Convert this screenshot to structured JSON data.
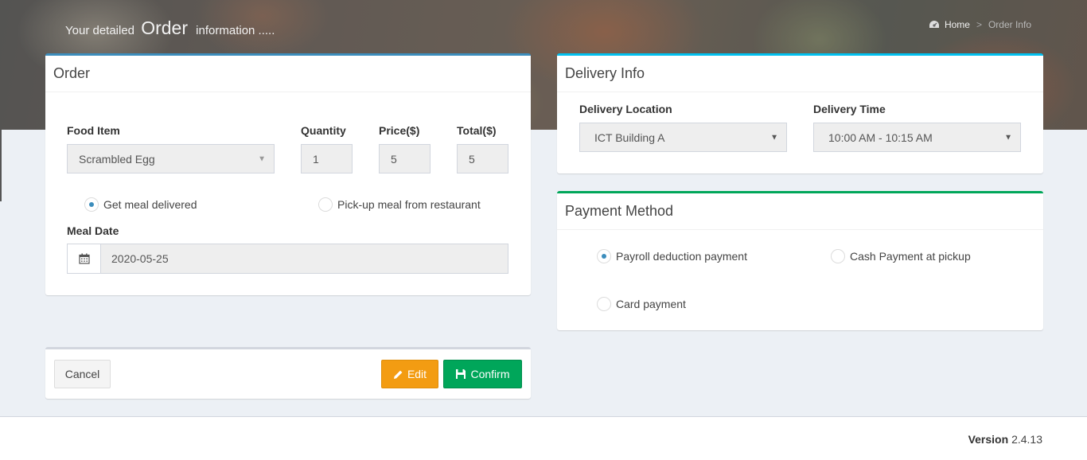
{
  "header": {
    "title_prefix": "Your detailed",
    "title_emphasis": "Order",
    "title_suffix": "information .....",
    "breadcrumb": {
      "home": "Home",
      "current": "Order Info"
    }
  },
  "order": {
    "title": "Order",
    "food_item_label": "Food Item",
    "food_item_value": "Scrambled Egg",
    "quantity_label": "Quantity",
    "quantity_value": "1",
    "price_label": "Price($)",
    "price_value": "5",
    "total_label": "Total($)",
    "total_value": "5",
    "option_delivered": "Get meal delivered",
    "option_pickup": "Pick-up meal from restaurant",
    "meal_date_label": "Meal Date",
    "meal_date_value": "2020-05-25"
  },
  "delivery": {
    "title": "Delivery Info",
    "location_label": "Delivery Location",
    "location_value": "ICT Building A",
    "time_label": "Delivery Time",
    "time_value": "10:00 AM - 10:15 AM"
  },
  "payment": {
    "title": "Payment Method",
    "option_payroll": "Payroll deduction payment",
    "option_cash": "Cash Payment at pickup",
    "option_card": "Card payment"
  },
  "actions": {
    "cancel": "Cancel",
    "edit": "Edit",
    "confirm": "Confirm"
  },
  "footer": {
    "version_label": "Version",
    "version_value": "2.4.13"
  },
  "colors": {
    "primary": "#3c8dbc",
    "info": "#00c0ef",
    "success": "#00a65a",
    "warning": "#f39c12"
  }
}
